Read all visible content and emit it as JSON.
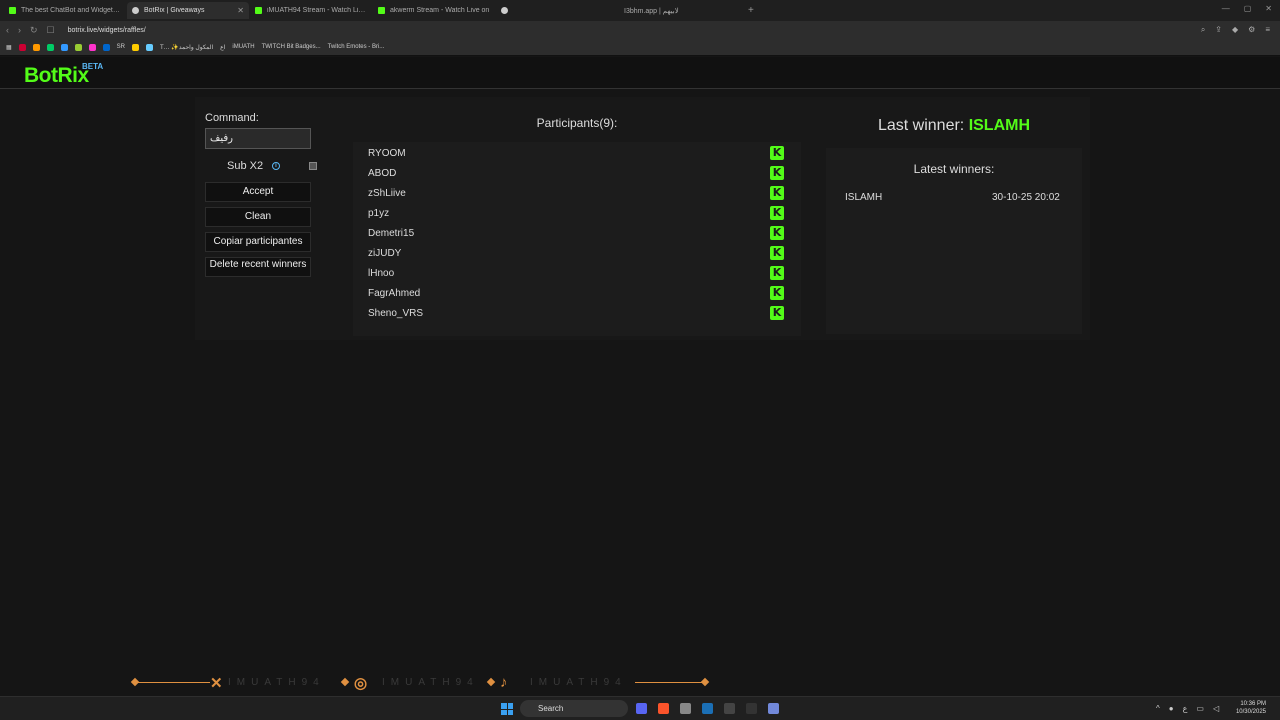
{
  "browser": {
    "tabs": [
      {
        "label": "The best ChatBot and Widgets for Ki",
        "favicon": "kick"
      },
      {
        "label": "BotRix | Giveaways",
        "active": true
      },
      {
        "label": "iMUATH94 Stream - Watch Live o",
        "favicon": "kick"
      },
      {
        "label": "akwerm Stream - Watch Live on",
        "favicon": "kick"
      },
      {
        "label": ""
      },
      {
        "label": "I3bhm.app | لابيهم"
      }
    ],
    "new_tab_icon": "+",
    "url": "botrix.live/widgets/raffles/",
    "bookmarks": [
      "SR",
      "T… ✨المكول واحمد",
      "اع",
      "iMUATH",
      "TWITCH Bit Badges...",
      "Twitch Emotes - Bri..."
    ]
  },
  "app": {
    "logo": "BotRix",
    "beta": "BETA"
  },
  "controls": {
    "command_label": "Command:",
    "command_value": "رفيف",
    "sub_label": "Sub X2",
    "sub_checked": false,
    "accept": "Accept",
    "clean": "Clean",
    "copy": "Copiar participantes",
    "delete_recent": "Delete recent winners"
  },
  "participants": {
    "title": "Participants(9):",
    "names": [
      "RYOOM",
      "ABOD",
      "zShLiive",
      "p1yz",
      "Demetri15",
      "ziJUDY",
      "lHnoo",
      "FagrAhmed",
      "Sheno_VRS"
    ]
  },
  "winners": {
    "last_winner_label": "Last winner:",
    "last_winner": "ISLAMH",
    "latest_title": "Latest winners:",
    "list": [
      {
        "name": "ISLAMH",
        "date": "30-10-25 20:02"
      }
    ]
  },
  "overlay": {
    "handle": "IMUATH94"
  },
  "taskbar": {
    "search": "Search",
    "time": "10:36 PM",
    "date": "10/30/2025"
  },
  "colors": {
    "accent": "#53fc18",
    "beta": "#5ab8f5",
    "overlay": "#e09040"
  }
}
